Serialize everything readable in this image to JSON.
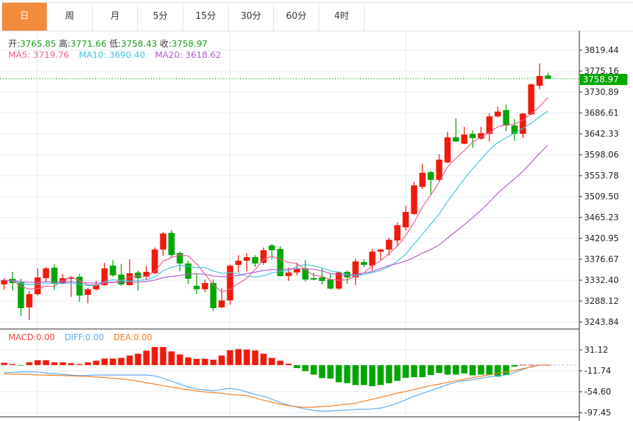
{
  "tabs": [
    {
      "label": "日",
      "active": true
    },
    {
      "label": "周",
      "active": false
    },
    {
      "label": "月",
      "active": false
    },
    {
      "label": "5分",
      "active": false
    },
    {
      "label": "15分",
      "active": false
    },
    {
      "label": "30分",
      "active": false
    },
    {
      "label": "60分",
      "active": false
    },
    {
      "label": "4时",
      "active": false
    }
  ],
  "ohlc_legend": {
    "open_label": "开:",
    "open": "3765.85",
    "high_label": "高:",
    "high": "3771.66",
    "low_label": "低:",
    "low": "3758.43",
    "close_label": "收:",
    "close": "3758.97"
  },
  "ma_legend": {
    "ma5_label": "MA5:",
    "ma5": "3719.76",
    "ma10_label": "MA10:",
    "ma10": "3690.40",
    "ma20_label": "MA20:",
    "ma20": "3618.62"
  },
  "macd_legend": {
    "macd": "MACD:0.00",
    "diff": "DIFF:0.00",
    "dea": "DEA:0.00"
  },
  "current_price_tag": "3758.97",
  "colors": {
    "up": "#f01a0c",
    "down": "#00a600",
    "ma5": "#ef5b8e",
    "ma10": "#3fc6dc",
    "ma20": "#b35ac8",
    "diff": "#5aa8ee",
    "dea": "#f57c1f",
    "macd_label": "#f04040",
    "active_tab": "#f28b3c",
    "price_tag": "#00a800"
  },
  "chart_data": [
    {
      "type": "candlestick",
      "grid": true,
      "y_ticks": [
        "3819.44",
        "3775.16",
        "3730.89",
        "3686.61",
        "3642.33",
        "3598.06",
        "3553.78",
        "3509.50",
        "3465.23",
        "3420.95",
        "3376.67",
        "3332.40",
        "3288.12",
        "3243.84"
      ],
      "ylim": [
        3243.84,
        3819.44
      ],
      "current_price": 3758.97,
      "ohlc": [
        [
          3323.5,
          3336.8,
          3311.7,
          3332.4
        ],
        [
          3335.3,
          3350.1,
          3310.2,
          3326.4
        ],
        [
          3327.9,
          3335.3,
          3257.0,
          3273.3
        ],
        [
          3274.8,
          3308.7,
          3248.2,
          3302.8
        ],
        [
          3302.8,
          3357.4,
          3300.0,
          3338.3
        ],
        [
          3336.8,
          3360.4,
          3327.9,
          3357.4
        ],
        [
          3358.9,
          3366.3,
          3311.7,
          3324.9
        ],
        [
          3324.9,
          3345.6,
          3323.5,
          3336.8
        ],
        [
          3335.3,
          3341.2,
          3296.9,
          3338.3
        ],
        [
          3339.7,
          3345.6,
          3286.6,
          3299.9
        ],
        [
          3301.3,
          3316.1,
          3283.6,
          3313.2
        ],
        [
          3313.2,
          3330.9,
          3310.2,
          3323.5
        ],
        [
          3322.0,
          3369.3,
          3320.5,
          3357.4
        ],
        [
          3363.3,
          3375.1,
          3339.7,
          3342.7
        ],
        [
          3344.2,
          3366.3,
          3320.5,
          3323.5
        ],
        [
          3322.0,
          3376.6,
          3320.5,
          3347.1
        ],
        [
          3348.6,
          3353.0,
          3310.2,
          3336.8
        ],
        [
          3339.7,
          3361.9,
          3332.4,
          3350.1
        ],
        [
          3347.1,
          3401.7,
          3345.6,
          3397.3
        ],
        [
          3397.3,
          3434.2,
          3384.0,
          3431.3
        ],
        [
          3432.7,
          3438.6,
          3381.1,
          3385.5
        ],
        [
          3389.9,
          3392.8,
          3351.5,
          3367.8
        ],
        [
          3367.8,
          3373.7,
          3324.9,
          3335.3
        ],
        [
          3320.5,
          3345.6,
          3302.8,
          3313.2
        ],
        [
          3313.2,
          3333.8,
          3307.3,
          3326.4
        ],
        [
          3326.4,
          3333.8,
          3267.4,
          3273.3
        ],
        [
          3274.8,
          3314.6,
          3273.3,
          3289.6
        ],
        [
          3289.6,
          3364.8,
          3280.7,
          3363.3
        ],
        [
          3364.8,
          3385.5,
          3348.6,
          3373.7
        ],
        [
          3373.7,
          3389.9,
          3351.5,
          3381.1
        ],
        [
          3381.1,
          3385.5,
          3360.4,
          3367.8
        ],
        [
          3369.3,
          3401.7,
          3364.8,
          3395.8
        ],
        [
          3406.1,
          3409.1,
          3376.6,
          3395.8
        ],
        [
          3398.7,
          3404.7,
          3340.0,
          3341.2
        ],
        [
          3341.2,
          3358.9,
          3330.9,
          3348.6
        ],
        [
          3348.6,
          3369.3,
          3342.7,
          3356.0
        ],
        [
          3357.4,
          3375.1,
          3329.4,
          3333.8
        ],
        [
          3336.8,
          3348.6,
          3332.4,
          3333.8
        ],
        [
          3338.3,
          3358.9,
          3323.5,
          3330.9
        ],
        [
          3333.8,
          3345.6,
          3313.0,
          3314.6
        ],
        [
          3314.6,
          3350.0,
          3311.7,
          3348.6
        ],
        [
          3350.1,
          3353.0,
          3324.9,
          3338.3
        ],
        [
          3338.3,
          3378.1,
          3322.0,
          3372.2
        ],
        [
          3370.7,
          3376.6,
          3360.4,
          3364.8
        ],
        [
          3363.3,
          3398.7,
          3353.0,
          3392.8
        ],
        [
          3392.8,
          3398.7,
          3375.1,
          3397.3
        ],
        [
          3397.3,
          3422.4,
          3384.0,
          3418.0
        ],
        [
          3416.5,
          3454.9,
          3404.7,
          3448.9
        ],
        [
          3444.5,
          3490.3,
          3437.1,
          3477.0
        ],
        [
          3472.6,
          3540.5,
          3471.1,
          3533.1
        ],
        [
          3530.1,
          3578.9,
          3525.7,
          3559.7
        ],
        [
          3561.1,
          3564.1,
          3513.9,
          3544.9
        ],
        [
          3544.9,
          3599.5,
          3543.0,
          3587.7
        ],
        [
          3581.8,
          3646.7,
          3580.0,
          3634.9
        ],
        [
          3634.9,
          3674.8,
          3625.0,
          3626.1
        ],
        [
          3621.6,
          3657.1,
          3620.2,
          3640.8
        ],
        [
          3642.3,
          3649.7,
          3612.8,
          3633.4
        ],
        [
          3631.9,
          3657.1,
          3630.0,
          3643.8
        ],
        [
          3642.3,
          3685.1,
          3626.1,
          3679.2
        ],
        [
          3679.2,
          3699.9,
          3677.0,
          3689.5
        ],
        [
          3692.5,
          3704.3,
          3648.2,
          3660.0
        ],
        [
          3660.0,
          3673.3,
          3627.5,
          3642.3
        ],
        [
          3642.3,
          3686.6,
          3633.4,
          3685.1
        ],
        [
          3683.6,
          3748.6,
          3682.2,
          3747.1
        ],
        [
          3744.2,
          3791.4,
          3736.8,
          3764.8
        ],
        [
          3765.85,
          3771.66,
          3758.43,
          3758.97
        ]
      ],
      "series": [
        {
          "name": "MA5",
          "period": 5
        },
        {
          "name": "MA10",
          "period": 10
        },
        {
          "name": "MA20",
          "period": 20
        }
      ]
    },
    {
      "type": "bar+line",
      "grid": true,
      "y_ticks": [
        "31.12",
        "-11.74",
        "-54.60",
        "-97.45"
      ],
      "ylim": [
        -97.45,
        31.12
      ],
      "macd": [
        4.8,
        2,
        -1,
        5.7,
        10,
        10,
        5.7,
        5.7,
        3.8,
        1.9,
        5.7,
        9,
        13.3,
        13.3,
        14.8,
        19.5,
        23.3,
        29.5,
        37,
        37,
        28,
        21.9,
        15.7,
        12.9,
        12.9,
        11,
        19.5,
        30.5,
        32.8,
        31.9,
        30,
        23.3,
        14.8,
        9,
        2.9,
        -6.2,
        -12.4,
        -19.5,
        -26.7,
        -27.6,
        -35.2,
        -37.1,
        -40.9,
        -40.9,
        -43.3,
        -40.9,
        -37.1,
        -32.4,
        -26.2,
        -24.8,
        -24.8,
        -20.5,
        -16.2,
        -19.5,
        -19.5,
        -17.1,
        -21,
        -19.5,
        -19.5,
        -23.8,
        -20.5,
        -3,
        0.5,
        0.5,
        0.3,
        0
      ],
      "diff": [
        -15.7,
        -15,
        -14,
        -13.8,
        -14.3,
        -16,
        -17.5,
        -19,
        -20.5,
        -21.5,
        -21,
        -20.5,
        -20.5,
        -20.5,
        -20.5,
        -20.5,
        -20.5,
        -20.5,
        -22,
        -27,
        -33,
        -39,
        -45,
        -49,
        -51,
        -52.8,
        -50,
        -47.6,
        -50,
        -55,
        -60,
        -64,
        -70,
        -77,
        -82,
        -86,
        -90,
        -93,
        -94.5,
        -94,
        -93,
        -92,
        -91,
        -90.5,
        -90,
        -88,
        -84,
        -78,
        -71,
        -64,
        -58,
        -52,
        -46,
        -40,
        -35,
        -32,
        -30,
        -27,
        -24,
        -22,
        -20,
        -15,
        -9,
        -3,
        0,
        0
      ],
      "dea": [
        -18,
        -18.5,
        -19,
        -19.5,
        -20,
        -20.5,
        -21,
        -21.5,
        -22,
        -22.8,
        -23.5,
        -24.5,
        -25.5,
        -27,
        -28.5,
        -30,
        -33,
        -36,
        -39,
        -42,
        -45,
        -48,
        -50.5,
        -53,
        -55,
        -56.5,
        -58,
        -60,
        -61.5,
        -63,
        -67,
        -72,
        -76,
        -80,
        -83,
        -85.5,
        -86.5,
        -86,
        -85,
        -84,
        -82,
        -80,
        -78,
        -74,
        -70,
        -66,
        -62,
        -57.5,
        -54,
        -50,
        -46,
        -42,
        -39,
        -35.5,
        -32,
        -29,
        -26,
        -23,
        -20,
        -17,
        -14,
        -11,
        -7.5,
        -4,
        0,
        0
      ]
    }
  ]
}
